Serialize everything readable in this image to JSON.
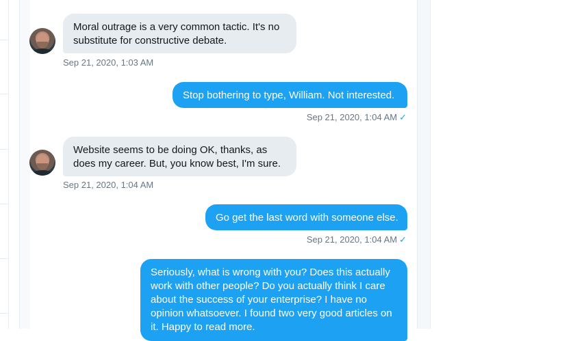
{
  "conversation": {
    "messages": [
      {
        "direction": "incoming",
        "lines": [
          "Moral outrage is a very common tactic. It's no",
          "substitute for constructive debate."
        ],
        "timestamp": "Sep 21, 2020, 1:03 AM"
      },
      {
        "direction": "outgoing",
        "lines": [
          "Stop bothering to type, William. Not interested."
        ],
        "timestamp": "Sep 21, 2020, 1:04 AM",
        "status_mark": "✓"
      },
      {
        "direction": "incoming",
        "lines": [
          "Website seems to be doing OK, thanks, as",
          "does my career. But, you know best, I'm sure."
        ],
        "timestamp": "Sep 21, 2020, 1:04 AM"
      },
      {
        "direction": "outgoing",
        "lines": [
          "Go get the last word with someone else."
        ],
        "timestamp": "Sep 21, 2020, 1:04 AM",
        "status_mark": "✓"
      },
      {
        "direction": "outgoing",
        "lines": [
          "Seriously, what is wrong with you? Does this actually",
          "work with other people? Do you actually think I care",
          "about the success of your enterprise? I have no",
          "opinion whatsoever. I found two very good articles on",
          "it. Happy to read more."
        ]
      }
    ]
  },
  "colors": {
    "outgoing_bubble": "#1da1f2",
    "incoming_bubble": "#e6ecf0",
    "timestamp_text": "#657786",
    "check_mark": "#1da1f2"
  },
  "icons": {
    "avatar": "avatar",
    "read_receipt": "check-icon"
  }
}
